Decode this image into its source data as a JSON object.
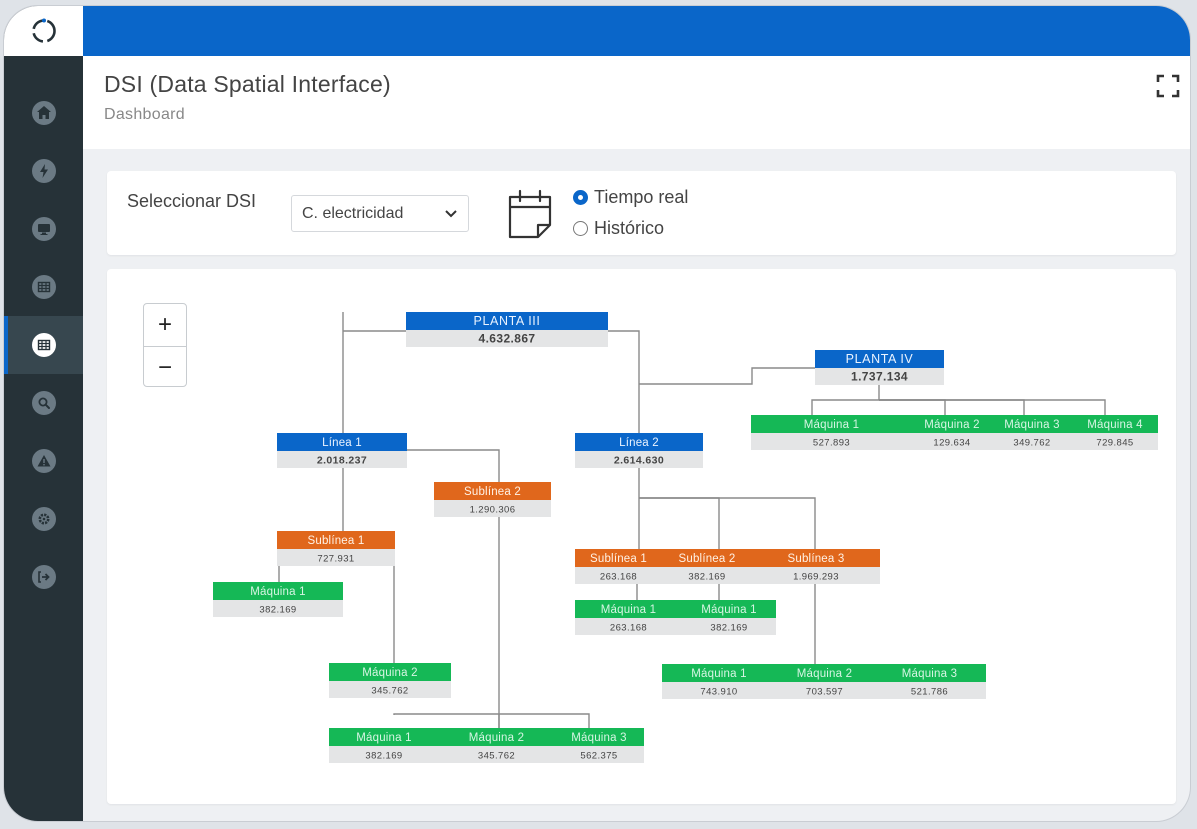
{
  "app": {
    "title": "DSI (Data Spatial Interface)",
    "breadcrumb": "Dashboard"
  },
  "sidebar": {
    "items": [
      {
        "icon": "home-icon"
      },
      {
        "icon": "bolt-icon"
      },
      {
        "icon": "monitor-icon"
      },
      {
        "icon": "table-icon"
      },
      {
        "icon": "table-icon",
        "active": true
      },
      {
        "icon": "search-icon"
      },
      {
        "icon": "warning-icon"
      },
      {
        "icon": "gear-icon"
      },
      {
        "icon": "logout-icon"
      }
    ]
  },
  "controls": {
    "select_label": "Seleccionar DSI",
    "select_value": "C. electricidad",
    "mode_options": [
      "Tiempo real",
      "Histórico"
    ],
    "mode_selected": "Tiempo real"
  },
  "zoom": {
    "in_label": "+",
    "out_label": "−"
  },
  "colors": {
    "planta": "#0a66c9",
    "linea": "#0a66c9",
    "sublinea": "#e0671c",
    "maquina": "#15b856",
    "value_bg": "#e4e5e6",
    "connector": "#8a8a8a",
    "topbar": "#0a66c9",
    "sidebar": "#263238"
  },
  "tree": {
    "nodes": [
      {
        "id": "planta3",
        "type": "planta",
        "titles": [
          "PLANTA III"
        ],
        "values": [
          "4.632.867"
        ]
      },
      {
        "id": "planta4",
        "type": "planta",
        "titles": [
          "PLANTA IV"
        ],
        "values": [
          "1.737.134"
        ]
      },
      {
        "id": "p4maq",
        "type": "maquina",
        "titles": [
          "Máquina 1",
          "Máquina 2",
          "Máquina 3",
          "Máquina 4"
        ],
        "values": [
          "527.893",
          "129.634",
          "349.762",
          "729.845"
        ]
      },
      {
        "id": "linea1",
        "type": "linea",
        "titles": [
          "Línea 1"
        ],
        "values": [
          "2.018.237"
        ]
      },
      {
        "id": "linea2",
        "type": "linea",
        "titles": [
          "Línea 2"
        ],
        "values": [
          "2.614.630"
        ]
      },
      {
        "id": "l1sub2",
        "type": "sublinea",
        "titles": [
          "Sublínea 2"
        ],
        "values": [
          "1.290.306"
        ]
      },
      {
        "id": "l1sub1",
        "type": "sublinea",
        "titles": [
          "Sublínea 1"
        ],
        "values": [
          "727.931"
        ]
      },
      {
        "id": "s1m1",
        "type": "maquina",
        "titles": [
          "Máquina 1"
        ],
        "values": [
          "382.169"
        ]
      },
      {
        "id": "s1m2",
        "type": "maquina",
        "titles": [
          "Máquina 2"
        ],
        "values": [
          "345.762"
        ]
      },
      {
        "id": "s2maq",
        "type": "maquina",
        "titles": [
          "Máquina 1",
          "Máquina 2",
          "Máquina 3"
        ],
        "values": [
          "382.169",
          "345.762",
          "562.375"
        ]
      },
      {
        "id": "l2subs",
        "type": "sublinea",
        "titles": [
          "Sublínea 1",
          "Sublínea 2",
          "Sublínea 3"
        ],
        "values": [
          "263.168",
          "382.169",
          "1.969.293"
        ]
      },
      {
        "id": "l2s12maq",
        "type": "maquina",
        "titles": [
          "Máquina 1",
          "Máquina 1"
        ],
        "values": [
          "263.168",
          "382.169"
        ]
      },
      {
        "id": "l2s3maq",
        "type": "maquina",
        "titles": [
          "Máquina 1",
          "Máquina 2",
          "Máquina 3"
        ],
        "values": [
          "743.910",
          "703.597",
          "521.786"
        ]
      }
    ]
  }
}
